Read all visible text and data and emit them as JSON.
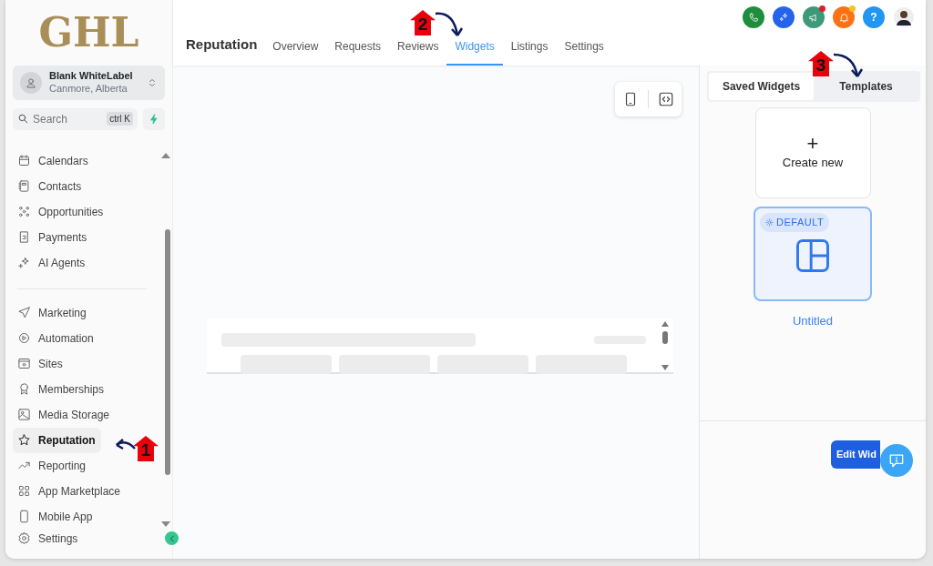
{
  "logo": "GHL",
  "account": {
    "name": "Blank WhiteLabel",
    "location": "Canmore, Alberta"
  },
  "search": {
    "placeholder": "Search",
    "shortcut": "ctrl K"
  },
  "sidebar": {
    "groups": [
      [
        {
          "label": "Calendars",
          "selected": false
        },
        {
          "label": "Contacts",
          "selected": false
        },
        {
          "label": "Opportunities",
          "selected": false
        },
        {
          "label": "Payments",
          "selected": false
        },
        {
          "label": "AI Agents",
          "selected": false
        }
      ],
      [
        {
          "label": "Marketing",
          "selected": false
        },
        {
          "label": "Automation",
          "selected": false
        },
        {
          "label": "Sites",
          "selected": false
        },
        {
          "label": "Memberships",
          "selected": false
        },
        {
          "label": "Media Storage",
          "selected": false
        },
        {
          "label": "Reputation",
          "selected": true
        },
        {
          "label": "Reporting",
          "selected": false
        },
        {
          "label": "App Marketplace",
          "selected": false
        },
        {
          "label": "Mobile App",
          "selected": false
        }
      ]
    ],
    "settings": "Settings"
  },
  "header": {
    "title": "Reputation",
    "tabs": [
      {
        "label": "Overview",
        "selected": false
      },
      {
        "label": "Requests",
        "selected": false
      },
      {
        "label": "Reviews",
        "selected": false
      },
      {
        "label": "Widgets",
        "selected": true
      },
      {
        "label": "Listings",
        "selected": false
      },
      {
        "label": "Settings",
        "selected": false
      }
    ],
    "actions": [
      {
        "color": "#1e8e3e",
        "notification": false
      },
      {
        "color": "#2563eb",
        "notification": false
      },
      {
        "color": "#3d9a78",
        "notification": true
      },
      {
        "color": "#f97316",
        "notification": true
      },
      {
        "color": "#2196f3",
        "notification": false,
        "label": "?"
      }
    ]
  },
  "panel": {
    "tabs": [
      {
        "label": "Saved Widgets",
        "selected": true
      },
      {
        "label": "Templates",
        "selected": false
      }
    ],
    "create": {
      "icon": "+",
      "label": "Create new"
    },
    "templates": [
      {
        "badge": "DEFAULT",
        "name": "Untitled",
        "selected": true
      }
    ],
    "button": "Edit Wid"
  },
  "annotations": [
    {
      "number": "1"
    },
    {
      "number": "2"
    },
    {
      "number": "3"
    }
  ]
}
